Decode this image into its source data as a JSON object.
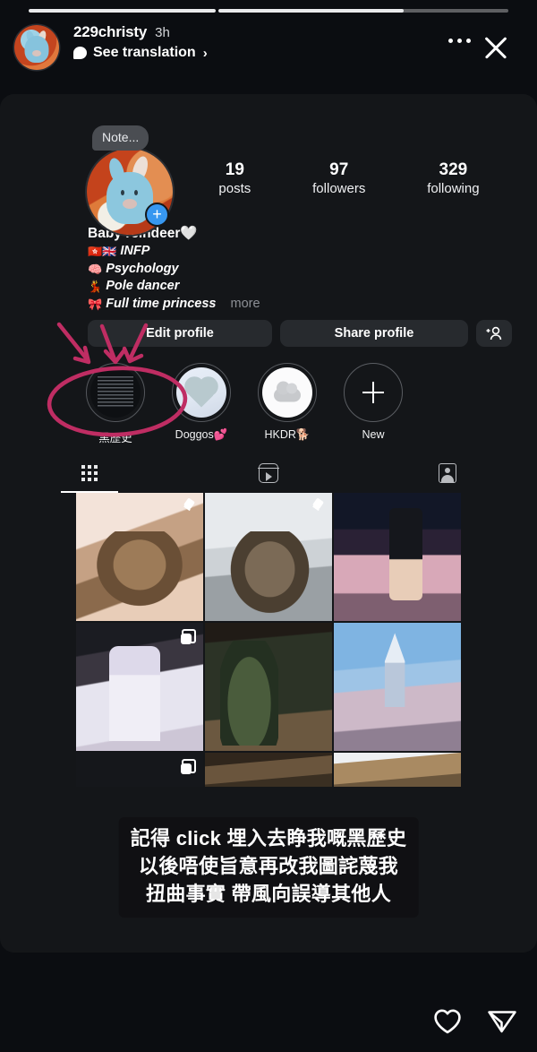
{
  "app": "instagram-story-viewer",
  "story": {
    "progress": [
      {
        "percent": 100
      },
      {
        "percent": 64
      }
    ],
    "header": {
      "username": "229christy",
      "timestamp": "3h",
      "translation_label": "See translation",
      "translation_chevron": "›",
      "avatar_name": "story-author-avatar",
      "more_icon": "more-options-icon",
      "close_icon": "close-icon"
    },
    "caption_lines": [
      "記得 click 埋入去睁我嘅黑歷史",
      "以後唔使旨意再改我圖詫蔑我",
      "扭曲事實 帶風向誤導其他人"
    ],
    "bottom": {
      "like_icon": "heart-icon",
      "share_icon": "send-icon"
    },
    "annotations": {
      "color": "#bf2d63",
      "arrow_count": 3,
      "circle_target": "黑歷史"
    }
  },
  "profile": {
    "note_bubble": "Note...",
    "add_story_badge": "+",
    "stats": [
      {
        "value": "19",
        "label": "posts"
      },
      {
        "value": "97",
        "label": "followers"
      },
      {
        "value": "329",
        "label": "following"
      }
    ],
    "bio": {
      "display_name": "Baby reindeer🤍",
      "lines": [
        {
          "emoji": "🇭🇰🇬🇧",
          "text": "INFP"
        },
        {
          "emoji": "🧠",
          "text": "Psychology"
        },
        {
          "emoji": "💃",
          "text": "Pole dancer"
        },
        {
          "emoji": "🎀",
          "text": "Full time princess"
        }
      ],
      "more_label": "more"
    },
    "buttons": {
      "edit": "Edit profile",
      "share": "Share profile",
      "add_user_icon": "add-person-icon"
    },
    "highlights": [
      {
        "label": "黑歷史",
        "kind": "text-screenshot"
      },
      {
        "label": "Doggos💕",
        "kind": "heart-photo"
      },
      {
        "label": "HKDR🐕",
        "kind": "cloud-photo"
      },
      {
        "label": "New",
        "kind": "add-new"
      }
    ],
    "tabs": [
      {
        "name": "grid",
        "icon": "grid-icon",
        "active": true
      },
      {
        "name": "reels",
        "icon": "reels-icon",
        "active": false
      },
      {
        "name": "tagged",
        "icon": "tagged-icon",
        "active": false
      }
    ],
    "grid_posts": [
      {
        "id": "c1",
        "badge": "pin"
      },
      {
        "id": "c2",
        "badge": "pin"
      },
      {
        "id": "c3",
        "badge": ""
      },
      {
        "id": "c4",
        "badge": "carousel"
      },
      {
        "id": "c5",
        "badge": ""
      },
      {
        "id": "c6",
        "badge": ""
      },
      {
        "id": "c7",
        "badge": "carousel"
      },
      {
        "id": "c8",
        "badge": ""
      },
      {
        "id": "c9",
        "badge": ""
      }
    ]
  }
}
